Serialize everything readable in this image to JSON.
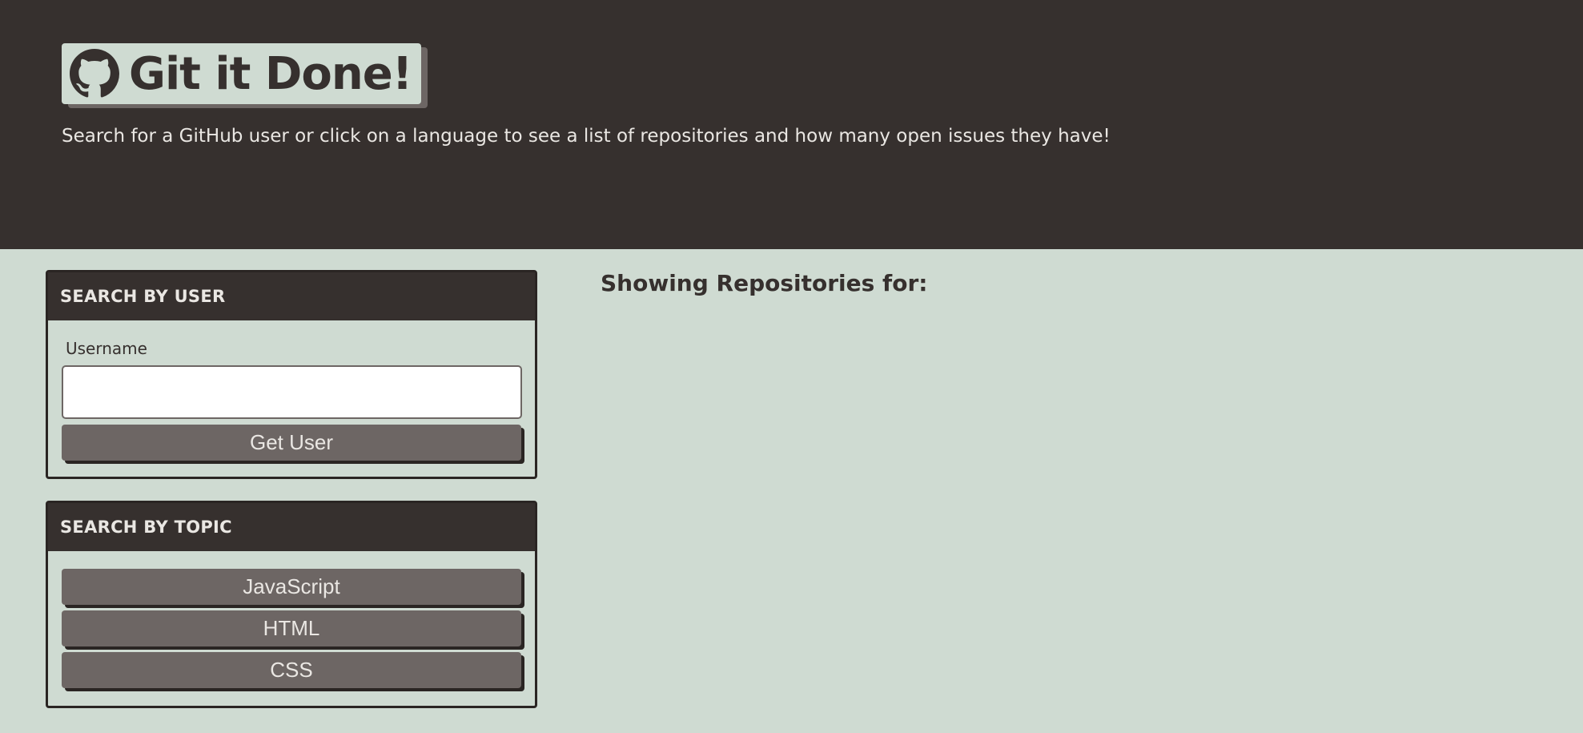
{
  "header": {
    "title": "Git it Done!",
    "subtitle": "Search for a GitHub user or click on a language to see a list of repositories and how many open issues they have!",
    "logo_icon": "github-icon"
  },
  "search_user": {
    "heading": "SEARCH BY USER",
    "label": "Username",
    "input_value": "",
    "button_label": "Get User"
  },
  "search_topic": {
    "heading": "SEARCH BY TOPIC",
    "languages": [
      "JavaScript",
      "HTML",
      "CSS"
    ]
  },
  "repos": {
    "heading": "Showing Repositories for:",
    "search_term": ""
  },
  "colors": {
    "dark": "#36302e",
    "background": "#cfdbd2",
    "button": "#6d6664",
    "light_text": "#eae7e3"
  }
}
